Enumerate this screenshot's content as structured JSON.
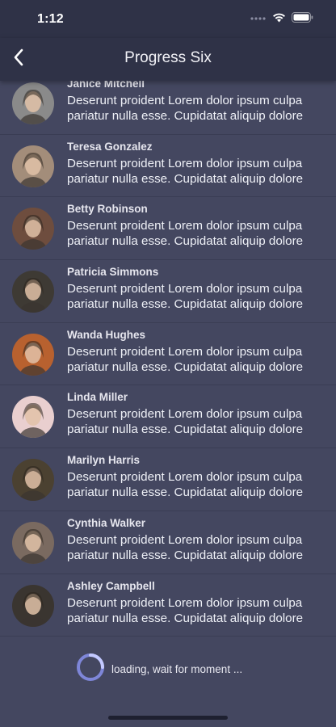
{
  "status_bar": {
    "time": "1:12"
  },
  "nav": {
    "title": "Progress Six"
  },
  "colors": {
    "background": "#444760",
    "nav": "#2f3247",
    "spinner": "#aab4ff"
  },
  "items": [
    {
      "name": "Janice Mitchell",
      "line1": "Deserunt proident Lorem dolor ipsum culpa",
      "line2": "pariatur nulla esse. Cupidatat aliquip dolore",
      "avatar_color": "#8a8a8a"
    },
    {
      "name": "Teresa Gonzalez",
      "line1": "Deserunt proident Lorem dolor ipsum culpa",
      "line2": "pariatur nulla esse. Cupidatat aliquip dolore",
      "avatar_color": "#a38d7a"
    },
    {
      "name": "Betty Robinson",
      "line1": "Deserunt proident Lorem dolor ipsum culpa",
      "line2": "pariatur nulla esse. Cupidatat aliquip dolore",
      "avatar_color": "#6e4d3e"
    },
    {
      "name": "Patricia Simmons",
      "line1": "Deserunt proident Lorem dolor ipsum culpa",
      "line2": "pariatur nulla esse. Cupidatat aliquip dolore",
      "avatar_color": "#3e3a34"
    },
    {
      "name": "Wanda Hughes",
      "line1": "Deserunt proident Lorem dolor ipsum culpa",
      "line2": "pariatur nulla esse. Cupidatat aliquip dolore",
      "avatar_color": "#b8612f"
    },
    {
      "name": "Linda Miller",
      "line1": "Deserunt proident Lorem dolor ipsum culpa",
      "line2": "pariatur nulla esse. Cupidatat aliquip dolore",
      "avatar_color": "#e9cfcf"
    },
    {
      "name": "Marilyn Harris",
      "line1": "Deserunt proident Lorem dolor ipsum culpa",
      "line2": "pariatur nulla esse. Cupidatat aliquip dolore",
      "avatar_color": "#4b4131"
    },
    {
      "name": "Cynthia Walker",
      "line1": "Deserunt proident Lorem dolor ipsum culpa",
      "line2": "pariatur nulla esse. Cupidatat aliquip dolore",
      "avatar_color": "#7a6a60"
    },
    {
      "name": "Ashley Campbell",
      "line1": "Deserunt proident Lorem dolor ipsum culpa",
      "line2": "pariatur nulla esse. Cupidatat aliquip dolore",
      "avatar_color": "#3a3530"
    }
  ],
  "loading": {
    "text": "loading, wait for moment ..."
  }
}
